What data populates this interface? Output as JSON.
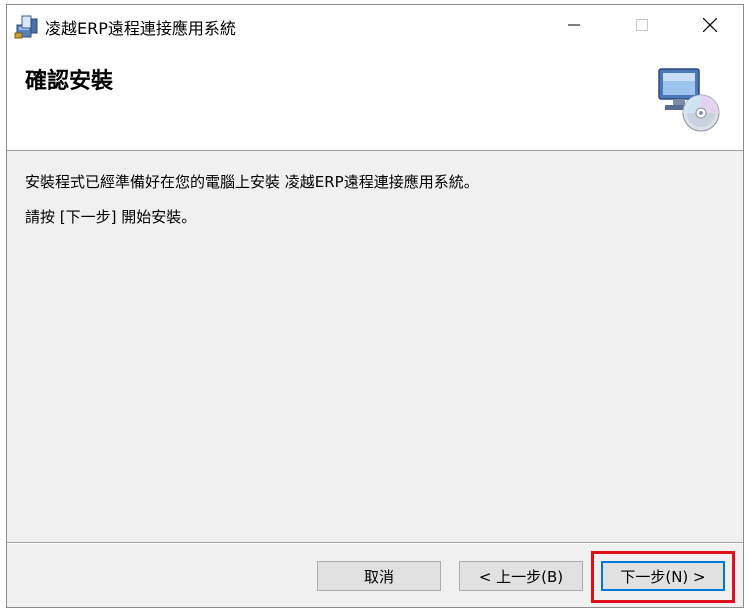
{
  "window": {
    "title": "凌越ERP遠程連接應用系統",
    "minimize_glyph": "—",
    "maximize_glyph": "☐",
    "close_glyph": "✕"
  },
  "header": {
    "title": "確認安裝",
    "icon": "computer-cd-icon"
  },
  "content": {
    "line1": "安裝程式已經準備好在您的電腦上安裝 凌越ERP遠程連接應用系統。",
    "line2": "請按 [下一步] 開始安裝。"
  },
  "buttons": {
    "cancel_label": "取消",
    "back_label": "< 上一步(B)",
    "next_label": "下一步(N) >"
  },
  "colors": {
    "highlight": "#e0101a",
    "focus_border": "#0078d7"
  }
}
